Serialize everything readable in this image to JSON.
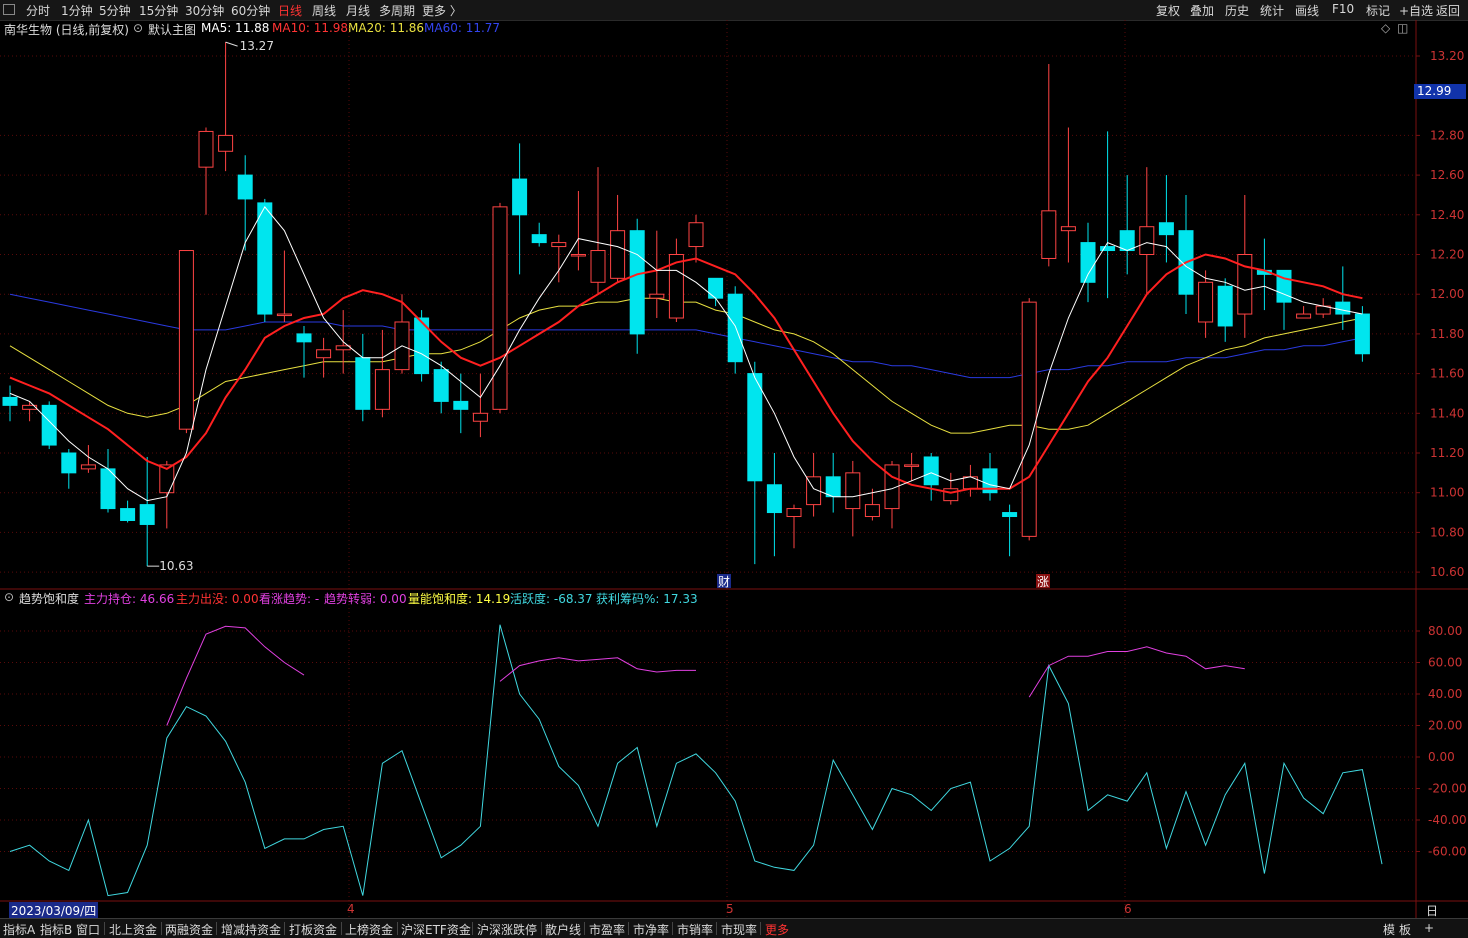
{
  "toolbar": {
    "left": [
      "分时",
      "1分钟",
      "5分钟",
      "15分钟",
      "30分钟",
      "60分钟",
      "日线",
      "周线",
      "月线",
      "多周期",
      "更多 〉"
    ],
    "selected": "日线",
    "right": [
      "复权",
      "叠加",
      "历史",
      "统计",
      "画线",
      "F10",
      "标记",
      "+自选",
      "返回"
    ]
  },
  "title": {
    "stock": "南华生物 (日线,前复权)",
    "template": "默认主图",
    "ma5": "MA5: 11.88",
    "ma10": "MA10: 11.98",
    "ma20": "MA20: 11.86",
    "ma60": "MA60: 11.77"
  },
  "price_axis": [
    "13.20",
    "12.80",
    "12.60",
    "12.40",
    "12.20",
    "12.00",
    "11.80",
    "11.60",
    "11.40",
    "11.20",
    "11.00",
    "10.80",
    "10.60"
  ],
  "current_price": "12.99",
  "annotations": {
    "high": "13.27",
    "low": "10.63",
    "cai": "财",
    "zhang": "涨"
  },
  "indicator": {
    "name": "趋势饱和度",
    "zhuli_chicang": "主力持仓: 46.66",
    "zhuli_chumo": "主力出没: 0.00",
    "kanzhang": "看涨趋势: -",
    "qushi_zhuanruo": "趋势转弱: 0.00",
    "liangneng": "量能饱和度: 14.19",
    "huoyuedu": "活跃度: -68.37",
    "huoli_chouma": "获利筹码%: 17.33",
    "axis": [
      "80.00",
      "60.00",
      "40.00",
      "20.00",
      "0.00",
      "-20.00",
      "-40.00",
      "-60.00"
    ]
  },
  "dates": {
    "current": "2023/03/09/四",
    "m4": "4",
    "m5": "5",
    "m6": "6",
    "period": "日线"
  },
  "bottom_tabs": [
    "指标A",
    "指标B",
    "窗口",
    "北上资金",
    "两融资金",
    "增减持资金",
    "打板资金",
    "上榜资金",
    "沪深ETF资金",
    "沪深涨跌停",
    "散户线",
    "市盈率",
    "市净率",
    "市销率",
    "市现率",
    "更多"
  ],
  "bottom_right": [
    "模",
    "板",
    "+"
  ],
  "colors": {
    "up": "#ff4444",
    "down": "#00e5ee",
    "ma5": "#ffffff",
    "ma10": "#ff2020",
    "ma20": "#e8e040",
    "ma60": "#2a3ae0",
    "grid": "#5a0a0a",
    "axis_text": "#cc3333",
    "magenta": "#e040e0",
    "cyan": "#40d8e0"
  },
  "chart_data": {
    "type": "candlestick",
    "y_range": [
      10.5,
      13.4
    ],
    "candles": [
      [
        11.48,
        11.44,
        11.54,
        11.36
      ],
      [
        11.42,
        11.44,
        11.46,
        11.36
      ],
      [
        11.44,
        11.24,
        11.46,
        11.22
      ],
      [
        11.2,
        11.1,
        11.22,
        11.02
      ],
      [
        11.12,
        11.14,
        11.24,
        11.1
      ],
      [
        11.12,
        10.92,
        11.22,
        10.9
      ],
      [
        10.92,
        10.86,
        10.96,
        10.85
      ],
      [
        10.94,
        10.84,
        11.18,
        10.63
      ],
      [
        11.0,
        11.14,
        11.16,
        10.82
      ],
      [
        11.32,
        12.22,
        12.22,
        11.3
      ],
      [
        12.64,
        12.82,
        12.84,
        12.4
      ],
      [
        12.72,
        12.8,
        13.27,
        12.62
      ],
      [
        12.6,
        12.48,
        12.7,
        12.22
      ],
      [
        12.46,
        11.9,
        12.48,
        11.86
      ],
      [
        11.9,
        11.9,
        12.22,
        11.86
      ],
      [
        11.8,
        11.76,
        11.84,
        11.58
      ],
      [
        11.68,
        11.72,
        11.78,
        11.58
      ],
      [
        11.72,
        11.74,
        11.92,
        11.6
      ],
      [
        11.68,
        11.42,
        11.8,
        11.36
      ],
      [
        11.42,
        11.62,
        11.82,
        11.38
      ],
      [
        11.62,
        11.86,
        12.0,
        11.6
      ],
      [
        11.88,
        11.6,
        11.92,
        11.56
      ],
      [
        11.62,
        11.46,
        11.66,
        11.4
      ],
      [
        11.46,
        11.42,
        11.6,
        11.3
      ],
      [
        11.36,
        11.4,
        11.6,
        11.28
      ],
      [
        11.42,
        12.44,
        12.46,
        11.4
      ],
      [
        12.58,
        12.4,
        12.76,
        12.1
      ],
      [
        12.3,
        12.26,
        12.36,
        12.24
      ],
      [
        12.24,
        12.26,
        12.3,
        12.06
      ],
      [
        12.2,
        12.2,
        12.52,
        12.12
      ],
      [
        12.06,
        12.22,
        12.64,
        12.0
      ],
      [
        12.08,
        12.32,
        12.5,
        12.06
      ],
      [
        12.32,
        11.8,
        12.38,
        11.7
      ],
      [
        11.98,
        12.0,
        12.32,
        11.88
      ],
      [
        11.88,
        12.2,
        12.28,
        11.86
      ],
      [
        12.24,
        12.36,
        12.4,
        12.16
      ],
      [
        12.08,
        11.98,
        12.06,
        11.94
      ],
      [
        12.0,
        11.66,
        12.04,
        11.6
      ],
      [
        11.6,
        11.06,
        11.66,
        10.64
      ],
      [
        11.04,
        10.9,
        11.2,
        10.68
      ],
      [
        10.88,
        10.92,
        10.94,
        10.72
      ],
      [
        10.94,
        11.08,
        11.2,
        10.88
      ],
      [
        11.08,
        10.98,
        11.2,
        10.9
      ],
      [
        10.92,
        11.1,
        11.16,
        10.78
      ],
      [
        10.88,
        10.94,
        11.02,
        10.86
      ],
      [
        10.92,
        11.14,
        11.16,
        10.82
      ],
      [
        11.14,
        11.14,
        11.2,
        11.06
      ],
      [
        11.18,
        11.04,
        11.2,
        10.96
      ],
      [
        10.96,
        11.02,
        11.1,
        10.94
      ],
      [
        11.02,
        11.08,
        11.14,
        10.98
      ],
      [
        11.12,
        11.0,
        11.2,
        10.96
      ],
      [
        10.9,
        10.88,
        10.94,
        10.68
      ],
      [
        10.78,
        11.96,
        11.98,
        10.76
      ],
      [
        12.18,
        12.42,
        13.16,
        12.14
      ],
      [
        12.32,
        12.34,
        12.84,
        12.16
      ],
      [
        12.26,
        12.06,
        12.36,
        11.96
      ],
      [
        12.24,
        12.22,
        12.82,
        11.98
      ],
      [
        12.32,
        12.22,
        12.6,
        12.1
      ],
      [
        12.2,
        12.34,
        12.64,
        12.0
      ],
      [
        12.36,
        12.3,
        12.6,
        12.16
      ],
      [
        12.32,
        12.0,
        12.5,
        11.9
      ],
      [
        11.86,
        12.06,
        12.12,
        11.78
      ],
      [
        12.04,
        11.84,
        12.08,
        11.76
      ],
      [
        11.9,
        12.2,
        12.5,
        11.78
      ],
      [
        12.12,
        12.1,
        12.28,
        11.92
      ],
      [
        12.12,
        11.96,
        12.12,
        11.82
      ],
      [
        11.88,
        11.9,
        11.94,
        11.88
      ],
      [
        11.9,
        11.94,
        11.98,
        11.88
      ],
      [
        11.96,
        11.9,
        12.14,
        11.82
      ],
      [
        11.9,
        11.7,
        11.94,
        11.66
      ]
    ],
    "ma5": [
      11.5,
      11.46,
      11.36,
      11.26,
      11.18,
      11.12,
      11.02,
      10.96,
      10.98,
      11.2,
      11.62,
      11.94,
      12.26,
      12.44,
      12.32,
      12.1,
      11.88,
      11.76,
      11.68,
      11.68,
      11.74,
      11.7,
      11.64,
      11.56,
      11.48,
      11.64,
      11.82,
      11.98,
      12.12,
      12.28,
      12.26,
      12.24,
      12.2,
      12.12,
      12.12,
      12.06,
      11.98,
      11.84,
      11.58,
      11.4,
      11.18,
      11.02,
      10.98,
      10.98,
      11.0,
      11.02,
      11.06,
      11.1,
      11.06,
      11.08,
      11.04,
      11.02,
      11.24,
      11.6,
      11.88,
      12.1,
      12.26,
      12.22,
      12.26,
      12.24,
      12.14,
      12.08,
      12.06,
      12.02,
      12.04,
      12.0,
      11.96,
      11.94,
      11.92,
      11.9
    ],
    "ma10": [
      11.58,
      11.54,
      11.5,
      11.44,
      11.38,
      11.32,
      11.24,
      11.16,
      11.12,
      11.18,
      11.3,
      11.48,
      11.62,
      11.78,
      11.84,
      11.88,
      11.9,
      11.98,
      12.02,
      12.0,
      11.96,
      11.86,
      11.76,
      11.68,
      11.64,
      11.68,
      11.74,
      11.8,
      11.86,
      11.94,
      12.0,
      12.06,
      12.1,
      12.12,
      12.16,
      12.18,
      12.14,
      12.1,
      12.0,
      11.88,
      11.72,
      11.56,
      11.4,
      11.26,
      11.16,
      11.08,
      11.04,
      11.02,
      11.0,
      11.02,
      11.02,
      11.02,
      11.08,
      11.24,
      11.4,
      11.56,
      11.68,
      11.84,
      12.0,
      12.1,
      12.16,
      12.2,
      12.18,
      12.14,
      12.12,
      12.08,
      12.06,
      12.04,
      12.0,
      11.98
    ],
    "ma20": [
      11.74,
      11.68,
      11.62,
      11.56,
      11.5,
      11.44,
      11.4,
      11.38,
      11.4,
      11.44,
      11.5,
      11.56,
      11.58,
      11.6,
      11.62,
      11.64,
      11.66,
      11.66,
      11.66,
      11.66,
      11.68,
      11.7,
      11.7,
      11.72,
      11.76,
      11.82,
      11.88,
      11.92,
      11.94,
      11.94,
      11.96,
      11.96,
      11.98,
      11.98,
      11.96,
      11.96,
      11.92,
      11.9,
      11.86,
      11.82,
      11.8,
      11.76,
      11.7,
      11.62,
      11.54,
      11.46,
      11.4,
      11.34,
      11.3,
      11.3,
      11.32,
      11.34,
      11.34,
      11.32,
      11.32,
      11.34,
      11.4,
      11.46,
      11.52,
      11.58,
      11.64,
      11.68,
      11.72,
      11.74,
      11.78,
      11.8,
      11.82,
      11.84,
      11.86,
      11.88
    ],
    "ma60": [
      12.0,
      11.98,
      11.96,
      11.94,
      11.92,
      11.9,
      11.88,
      11.86,
      11.84,
      11.82,
      11.82,
      11.82,
      11.84,
      11.86,
      11.86,
      11.86,
      11.86,
      11.84,
      11.84,
      11.84,
      11.82,
      11.82,
      11.82,
      11.82,
      11.82,
      11.82,
      11.82,
      11.82,
      11.82,
      11.82,
      11.82,
      11.82,
      11.82,
      11.82,
      11.82,
      11.82,
      11.8,
      11.78,
      11.76,
      11.74,
      11.72,
      11.7,
      11.68,
      11.66,
      11.66,
      11.64,
      11.64,
      11.62,
      11.6,
      11.58,
      11.58,
      11.58,
      11.6,
      11.62,
      11.62,
      11.64,
      11.64,
      11.66,
      11.66,
      11.66,
      11.68,
      11.68,
      11.68,
      11.7,
      11.72,
      11.72,
      11.74,
      11.74,
      11.76,
      11.78
    ],
    "indicator_cyan": [
      -60,
      -56,
      -66,
      -72,
      -40,
      -88,
      -86,
      -56,
      12,
      32,
      26,
      10,
      -16,
      -58,
      -52,
      -52,
      -46,
      -44,
      -88,
      -4,
      4,
      -30,
      -64,
      -56,
      -44,
      84,
      40,
      24,
      -6,
      -18,
      -44,
      -4,
      6,
      -44,
      -4,
      2,
      -10,
      -28,
      -66,
      -70,
      -72,
      -56,
      -2,
      -24,
      -46,
      -20,
      -24,
      -34,
      -20,
      -16,
      -66,
      -58,
      -44,
      58,
      34,
      -34,
      -24,
      -28,
      -10,
      -58,
      -22,
      -56,
      -24,
      -4,
      -74,
      -4,
      -26,
      -36,
      -10,
      -8,
      -68
    ],
    "indicator_magenta": [
      [
        8,
        20
      ],
      [
        9,
        50
      ],
      [
        10,
        78
      ],
      [
        11,
        83
      ],
      [
        12,
        82
      ],
      [
        13,
        70
      ],
      [
        14,
        60
      ],
      [
        15,
        52
      ],
      [
        25,
        48
      ],
      [
        26,
        58
      ],
      [
        27,
        61
      ],
      [
        28,
        63
      ],
      [
        29,
        61
      ],
      [
        30,
        62
      ],
      [
        31,
        63
      ],
      [
        32,
        56
      ],
      [
        33,
        54
      ],
      [
        34,
        55
      ],
      [
        35,
        55
      ],
      [
        52,
        38
      ],
      [
        53,
        58
      ],
      [
        54,
        64
      ],
      [
        55,
        64
      ],
      [
        56,
        67
      ],
      [
        57,
        67
      ],
      [
        58,
        70
      ],
      [
        59,
        66
      ],
      [
        60,
        64
      ],
      [
        61,
        56
      ],
      [
        62,
        58
      ],
      [
        63,
        56
      ]
    ]
  }
}
